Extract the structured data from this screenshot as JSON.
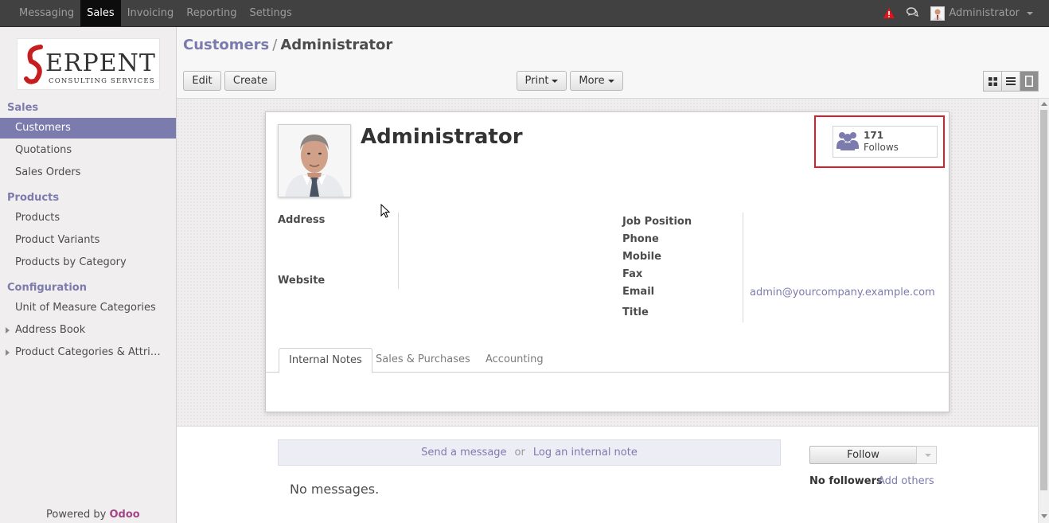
{
  "topbar": {
    "menu": [
      "Messaging",
      "Sales",
      "Invoicing",
      "Reporting",
      "Settings"
    ],
    "active_menu": "Sales",
    "user_name": "Administrator",
    "warning_color": "#e4141b"
  },
  "sidebar": {
    "logo": {
      "main": "SERPENT",
      "sub": "CONSULTING SERVICES"
    },
    "sections": [
      {
        "title": "Sales",
        "items": [
          "Customers",
          "Quotations",
          "Sales Orders"
        ]
      },
      {
        "title": "Products",
        "items": [
          "Products",
          "Product Variants",
          "Products by Category"
        ]
      },
      {
        "title": "Configuration",
        "items": [
          "Unit of Measure Categories",
          "Address Book",
          "Product Categories & Attri…"
        ]
      }
    ],
    "active_item": "Customers",
    "powered_by": "Powered by",
    "powered_brand": "Odoo"
  },
  "control_panel": {
    "breadcrumb_parent": "Customers",
    "breadcrumb_sep": "/",
    "breadcrumb_current": "Administrator",
    "edit_label": "Edit",
    "create_label": "Create",
    "print_label": "Print",
    "more_label": "More"
  },
  "record": {
    "name": "Administrator",
    "follows_count": "171",
    "follows_label": "Follows",
    "left_fields": {
      "address": "Address",
      "website": "Website"
    },
    "right_fields": {
      "job_position": "Job Position",
      "phone": "Phone",
      "mobile": "Mobile",
      "fax": "Fax",
      "email": "Email",
      "title": "Title"
    },
    "email_value": "admin@yourcompany.example.com",
    "tabs": [
      "Internal Notes",
      "Sales & Purchases",
      "Accounting"
    ],
    "active_tab": "Internal Notes"
  },
  "chatter": {
    "send_message": "Send a message",
    "or": "or",
    "log_note": "Log an internal note",
    "no_messages": "No messages.",
    "follow_label": "Follow",
    "no_followers": "No followers",
    "add_others": "Add others"
  },
  "colors": {
    "accent": "#7c7bad",
    "highlight_box": "#d9202a",
    "brand": "#a24689"
  }
}
